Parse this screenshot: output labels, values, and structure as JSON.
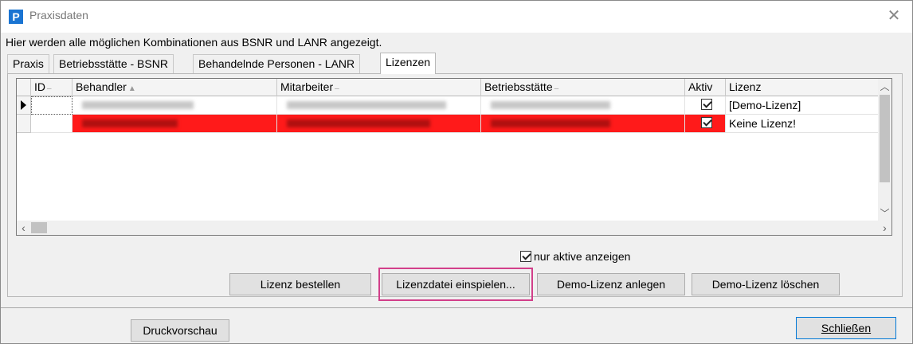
{
  "window": {
    "title": "Praxisdaten",
    "app_icon_letter": "P",
    "close_glyph": "✕"
  },
  "info_text": "Hier werden alle möglichen Kombinationen aus BSNR und LANR angezeigt.",
  "tabs": [
    {
      "label": "Praxis",
      "active": false
    },
    {
      "label": "Betriebsstätte - BSNR",
      "active": false
    },
    {
      "label": "Behandelnde Personen - LANR",
      "active": false
    },
    {
      "label": "Lizenzen",
      "active": true
    }
  ],
  "grid": {
    "columns": [
      "ID",
      "Behandler",
      "Mitarbeiter",
      "Betriebsstätte",
      "Aktiv",
      "Lizenz"
    ],
    "sort_markers": [
      "–",
      "▲",
      "–",
      "–",
      "",
      ""
    ],
    "rows": [
      {
        "aktiv": true,
        "lizenz": "[Demo-Lizenz]",
        "highlight": false
      },
      {
        "aktiv": true,
        "lizenz": "Keine Lizenz!",
        "highlight": true
      }
    ]
  },
  "only_active_label": "nur aktive anzeigen",
  "buttons": {
    "lizenz_bestellen": "Lizenz bestellen",
    "lizenzdatei_einspielen": "Lizenzdatei einspielen...",
    "demo_anlegen": "Demo-Lizenz anlegen",
    "demo_loeschen": "Demo-Lizenz löschen",
    "druckvorschau": "Druckvorschau",
    "schliessen": "Schließen"
  },
  "colors": {
    "accent": "#1a74d2",
    "row_highlight": "#ff1a1a",
    "focus_marker": "#d23f8a"
  }
}
